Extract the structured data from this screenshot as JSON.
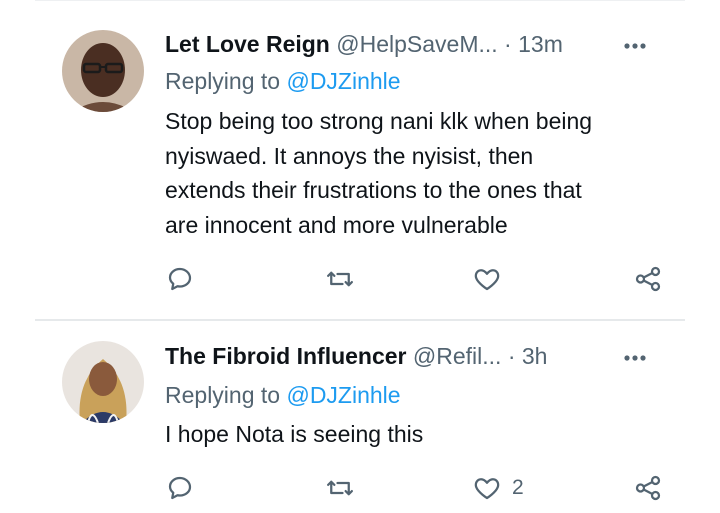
{
  "tweets": [
    {
      "display_name": "Let Love Reign",
      "handle": "@HelpSaveM...",
      "separator": "·",
      "time": "13m",
      "replying_prefix": "Replying to",
      "replying_to": "@DJZinhle",
      "text_lines": [
        "Stop being too strong nani klk when being",
        "nyiswaed. It annoys the nyisist, then",
        "extends their frustrations to the ones that",
        "are innocent and more vulnerable"
      ],
      "like_count": ""
    },
    {
      "display_name": "The Fibroid Influencer",
      "handle": "@Refil...",
      "separator": "·",
      "time": "3h",
      "replying_prefix": "Replying to",
      "replying_to": "@DJZinhle",
      "text_lines": [
        "I hope Nota is seeing this"
      ],
      "like_count": "2"
    }
  ],
  "icons": {
    "reply": "reply-icon",
    "retweet": "retweet-icon",
    "like": "like-icon",
    "share": "share-icon",
    "more": "more-icon"
  },
  "colors": {
    "text": "#0f1419",
    "secondary": "#536471",
    "link": "#1d9bf0",
    "divider": "#e6e9eb"
  }
}
